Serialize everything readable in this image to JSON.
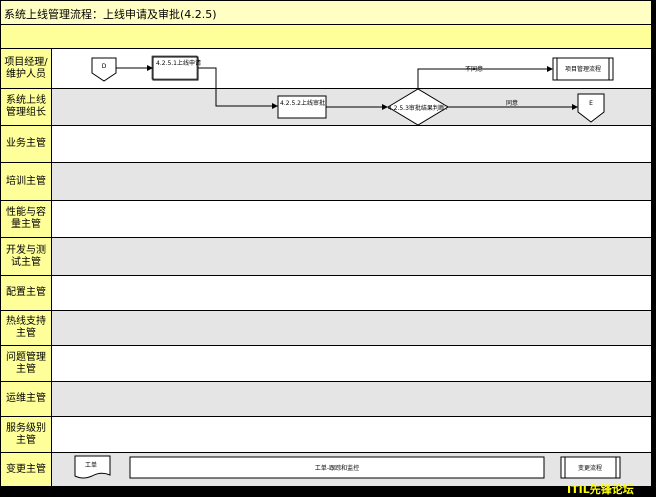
{
  "title": "系统上线管理流程：上线申请及审批(4.2.5)",
  "lanes": [
    {
      "label": "项目经理/维护人员",
      "shade": "white"
    },
    {
      "label": "系统上线管理组长",
      "shade": "gray"
    },
    {
      "label": "业务主管",
      "shade": "white"
    },
    {
      "label": "培训主管",
      "shade": "gray"
    },
    {
      "label": "性能与容量主管",
      "shade": "white"
    },
    {
      "label": "开发与测试主管",
      "shade": "gray"
    },
    {
      "label": "配置主管",
      "shade": "white"
    },
    {
      "label": "热线支持主管",
      "shade": "gray"
    },
    {
      "label": "问题管理主管",
      "shade": "white"
    },
    {
      "label": "运维主管",
      "shade": "gray"
    },
    {
      "label": "服务级别主管",
      "shade": "white"
    },
    {
      "label": "变更主管",
      "shade": "gray"
    }
  ],
  "nodes": {
    "start_d": "D",
    "apply": "4.2.5.1上线申请",
    "approve": "4.2.5.2上线审批",
    "decision": "4.2.5.3审批结果判断?",
    "project_mgmt": "项目管理流程",
    "end_e": "E",
    "ticket": "工单",
    "ticket_track": "工单-跟踪和监控",
    "change_flow": "变更流程"
  },
  "edges": {
    "disagree": "不同意",
    "agree": "同意"
  },
  "watermark": "ITIL先锋论坛"
}
